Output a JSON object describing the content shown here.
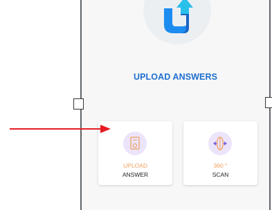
{
  "title": "UPLOAD ANSWERS",
  "cards": [
    {
      "top_label": "UPLOAD",
      "bottom_label": "ANSWER",
      "icon": "upload-document-icon"
    },
    {
      "top_label": "360 °",
      "bottom_label": "SCAN",
      "icon": "scan-360-icon"
    }
  ],
  "colors": {
    "accent_blue": "#1e6fd0",
    "orange_label": "#f0a05c",
    "icon_bg": "#ece4fb",
    "arrow_red": "#e51c23"
  },
  "app_logo_icon": "u-upload-logo-icon",
  "annotation_arrow_icon": "red-arrow-icon"
}
